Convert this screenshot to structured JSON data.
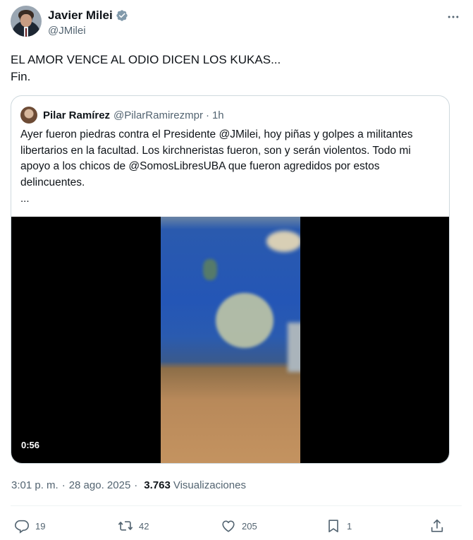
{
  "author": {
    "name": "Javier Milei",
    "handle": "@JMilei"
  },
  "tweet": {
    "lines": [
      "EL AMOR VENCE AL ODIO DICEN LOS KUKAS...",
      "Fin."
    ]
  },
  "quoted": {
    "name": "Pilar Ramírez",
    "handle": "@PilarRamirezmpr",
    "dot": "·",
    "time": "1h",
    "text": "Ayer fueron piedras contra el Presidente @JMilei, hoy piñas y golpes a militantes libertarios en la facultad. Los kirchneristas fueron, son y serán violentos. Todo mi apoyo a los chicos de @SomosLibresUBA que fueron agredidos por estos delincuentes.",
    "more": "...",
    "video_duration": "0:56"
  },
  "meta": {
    "time": "3:01 p. m.",
    "dot": "·",
    "date": "28 ago. 2025",
    "views": "3.763",
    "views_label": "Visualizaciones"
  },
  "actions": {
    "replies": "19",
    "reposts": "42",
    "likes": "205",
    "bookmarks": "1"
  },
  "colors": {
    "verified": "#829aab",
    "secondary": "#536471",
    "border": "#cfd9de"
  }
}
